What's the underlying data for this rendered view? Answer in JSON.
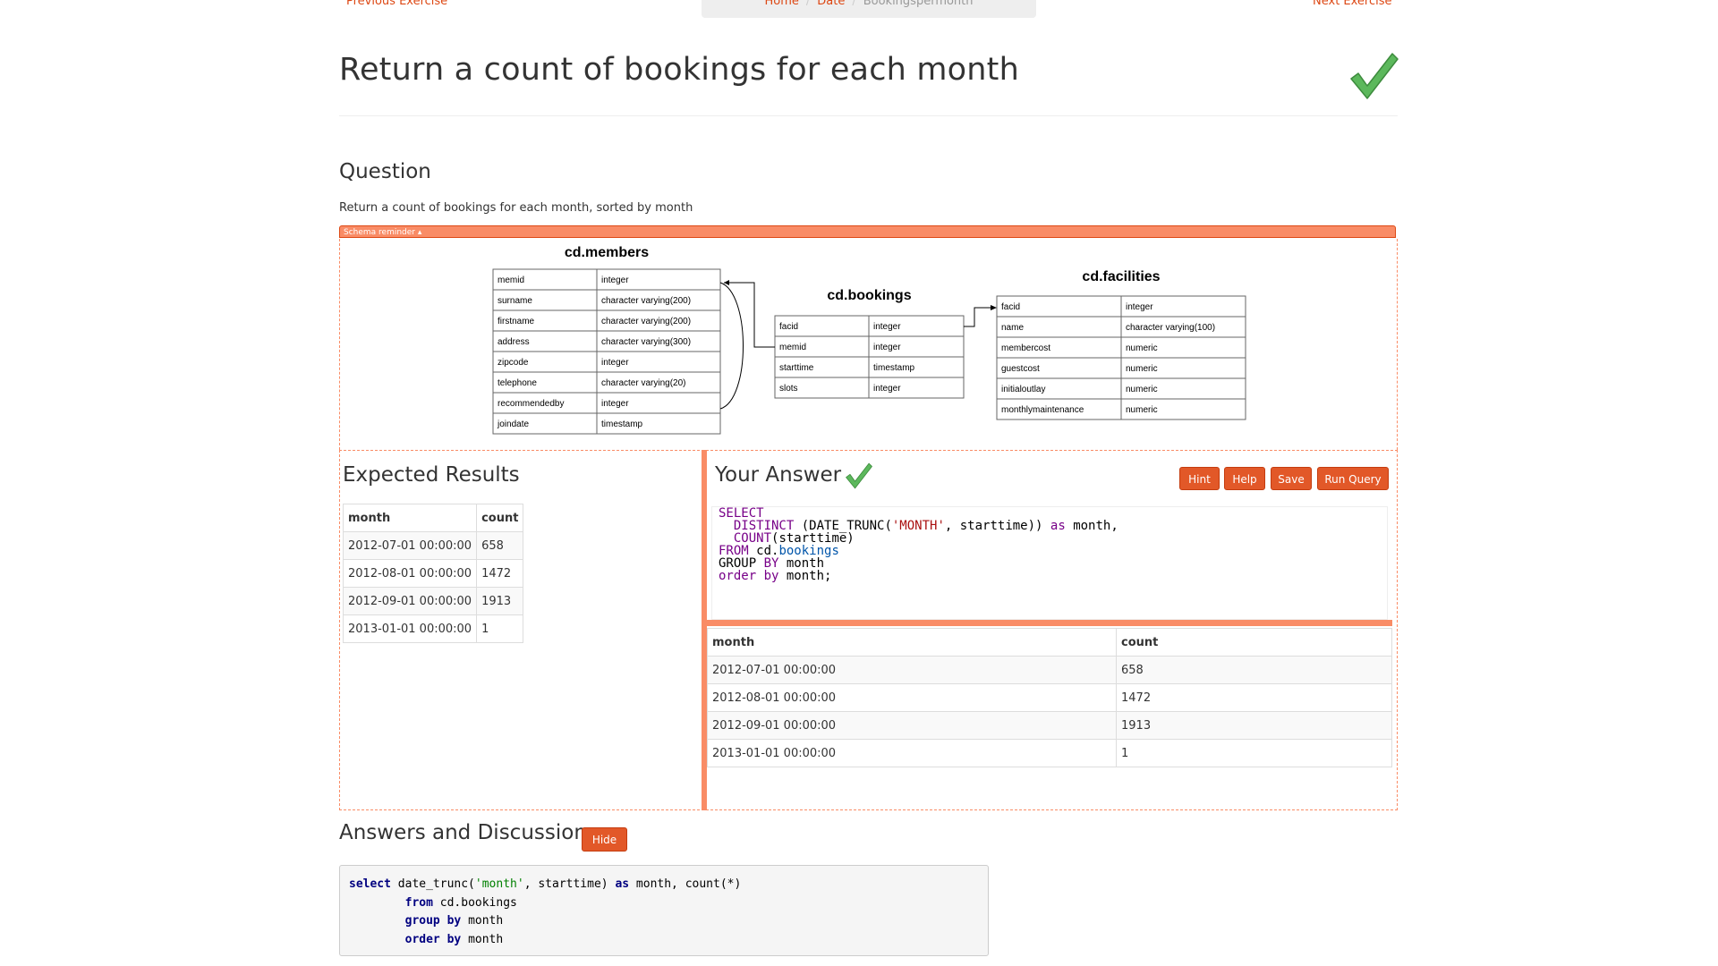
{
  "nav": {
    "prev_label": "Previous Exercise",
    "next_label": "Next Exercise",
    "breadcrumb": [
      "Home",
      "Date",
      "Bookingspermonth"
    ]
  },
  "page_title": "Return a count of bookings for each month",
  "question": {
    "heading": "Question",
    "text": "Return a count of bookings for each month, sorted by month"
  },
  "schema": {
    "toggle_label": "Schema reminder ▴",
    "tables": [
      {
        "name": "cd.members",
        "columns": [
          [
            "memid",
            "integer"
          ],
          [
            "surname",
            "character varying(200)"
          ],
          [
            "firstname",
            "character varying(200)"
          ],
          [
            "address",
            "character varying(300)"
          ],
          [
            "zipcode",
            "integer"
          ],
          [
            "telephone",
            "character varying(20)"
          ],
          [
            "recommendedby",
            "integer"
          ],
          [
            "joindate",
            "timestamp"
          ]
        ]
      },
      {
        "name": "cd.bookings",
        "columns": [
          [
            "facid",
            "integer"
          ],
          [
            "memid",
            "integer"
          ],
          [
            "starttime",
            "timestamp"
          ],
          [
            "slots",
            "integer"
          ]
        ]
      },
      {
        "name": "cd.facilities",
        "columns": [
          [
            "facid",
            "integer"
          ],
          [
            "name",
            "character varying(100)"
          ],
          [
            "membercost",
            "numeric"
          ],
          [
            "guestcost",
            "numeric"
          ],
          [
            "initialoutlay",
            "numeric"
          ],
          [
            "monthlymaintenance",
            "numeric"
          ]
        ]
      }
    ]
  },
  "expected": {
    "heading": "Expected Results",
    "columns": [
      "month",
      "count"
    ],
    "rows": [
      [
        "2012-07-01 00:00:00",
        "658"
      ],
      [
        "2012-08-01 00:00:00",
        "1472"
      ],
      [
        "2012-09-01 00:00:00",
        "1913"
      ],
      [
        "2013-01-01 00:00:00",
        "1"
      ]
    ]
  },
  "answer": {
    "heading": "Your Answer",
    "buttons": {
      "hint": "Hint",
      "help": "Help",
      "save": "Save",
      "run": "Run Query"
    },
    "query_lines": [
      "SELECT",
      "  DISTINCT (DATE_TRUNC('MONTH', starttime)) as month,",
      "  COUNT(starttime)",
      "FROM cd.bookings",
      "GROUP BY month",
      "order by month;"
    ],
    "result_columns": [
      "month",
      "count"
    ],
    "result_rows": [
      [
        "2012-07-01 00:00:00",
        "658"
      ],
      [
        "2012-08-01 00:00:00",
        "1472"
      ],
      [
        "2012-09-01 00:00:00",
        "1913"
      ],
      [
        "2013-01-01 00:00:00",
        "1"
      ]
    ]
  },
  "discussion": {
    "heading": "Answers and Discussion",
    "hide_label": "Hide",
    "solution_lines": [
      "select date_trunc('month', starttime) as month, count(*)",
      "        from cd.bookings",
      "        group by month",
      "        order by month"
    ]
  },
  "colors": {
    "accent": "#dd4814",
    "accent_light": "#f98c66",
    "success": "#5cb85c"
  }
}
